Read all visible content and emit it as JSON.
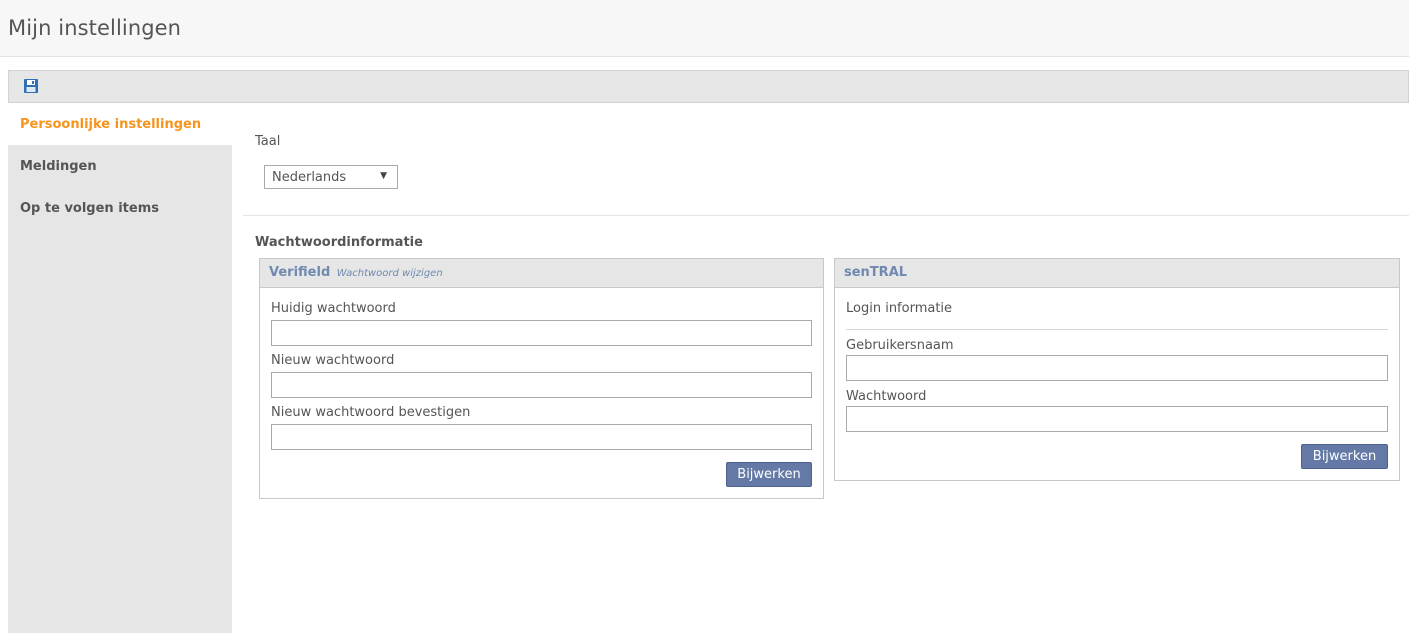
{
  "page": {
    "title": "Mijn instellingen"
  },
  "toolbar": {
    "save_icon": "floppy-disk-icon"
  },
  "sidebar": {
    "items": [
      {
        "label": "Persoonlijke instellingen",
        "active": true
      },
      {
        "label": "Meldingen",
        "active": false
      },
      {
        "label": "Op te volgen items",
        "active": false
      }
    ]
  },
  "language": {
    "label": "Taal",
    "selected": "Nederlands"
  },
  "password_section": {
    "heading": "Wachtwoordinformatie",
    "verifield": {
      "title": "Verifield",
      "subtitle": "Wachtwoord wijzigen",
      "current_label": "Huidig wachtwoord",
      "current_value": "",
      "new_label": "Nieuw wachtwoord",
      "new_value": "",
      "confirm_label": "Nieuw wachtwoord bevestigen",
      "confirm_value": "",
      "button": "Bijwerken"
    },
    "sentral": {
      "title": "senTRAL",
      "info": "Login informatie",
      "username_label": "Gebruikersnaam",
      "username_value": "",
      "password_label": "Wachtwoord",
      "password_value": "",
      "button": "Bijwerken"
    }
  },
  "colors": {
    "accent": "#f7941d",
    "panel_title": "#6f89b0",
    "button_bg": "#6479a5",
    "sidebar_bg": "#e6e6e6"
  }
}
